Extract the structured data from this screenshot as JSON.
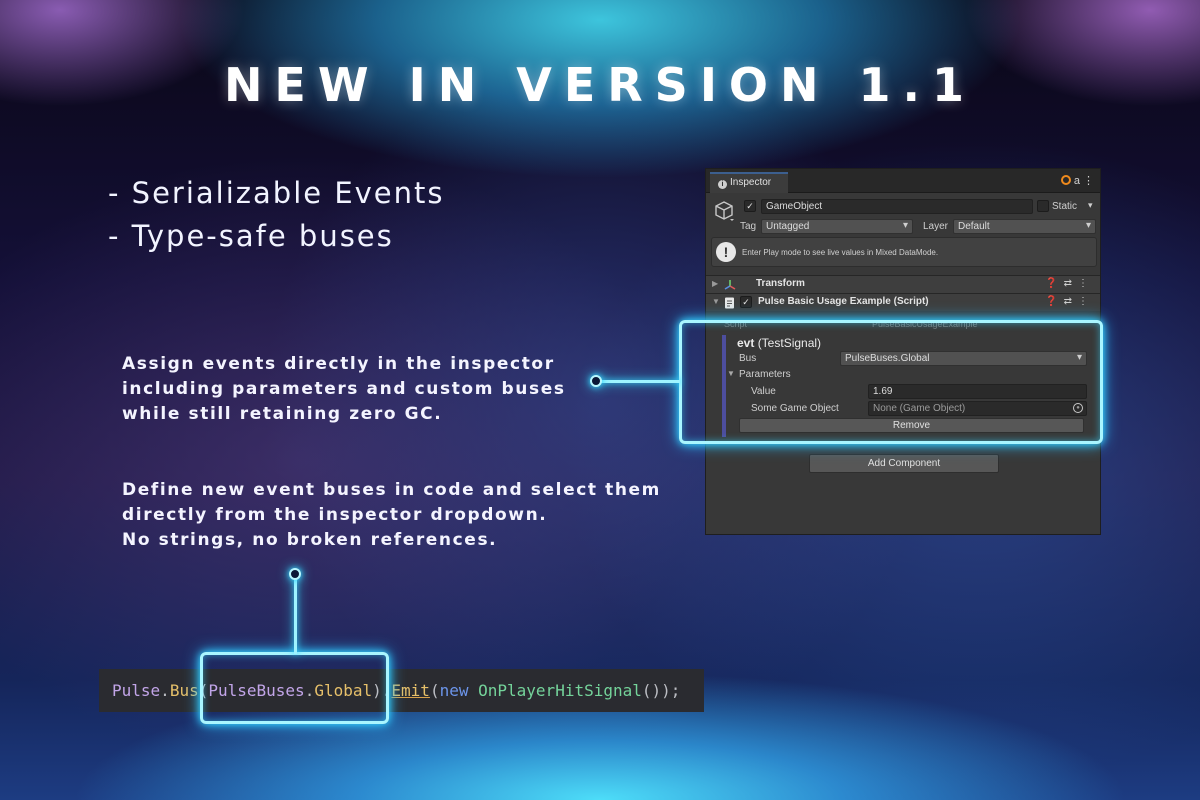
{
  "title": "NEW IN VERSION 1.1",
  "bullets": [
    "- Serializable Events",
    "- Type-safe buses"
  ],
  "paragraph1": [
    "Assign events directly in the inspector",
    "including parameters and custom buses",
    "while still retaining zero GC."
  ],
  "paragraph2": [
    "Define new event buses in code and select them",
    "directly from the inspector dropdown.",
    "No strings, no broken references."
  ],
  "inspector": {
    "tab_label": "Inspector",
    "tab_icon_text": "a",
    "gameobject": {
      "name": "GameObject",
      "static_label": "Static",
      "tag_label": "Tag",
      "tag_value": "Untagged",
      "layer_label": "Layer",
      "layer_value": "Default"
    },
    "help_message": "Enter Play mode to see live values in Mixed DataMode.",
    "components": {
      "transform": "Transform",
      "script": "Pulse Basic Usage Example (Script)"
    },
    "script_field": {
      "label": "Script",
      "value": "PulseBasicUsageExample"
    },
    "evt": {
      "name": "evt",
      "type": "(TestSignal)",
      "bus_label": "Bus",
      "bus_value": "PulseBuses.Global",
      "parameters_label": "Parameters",
      "value_label": "Value",
      "value": "1.69",
      "gameobject_label": "Some Game Object",
      "gameobject_value": "None (Game Object)",
      "remove_label": "Remove"
    },
    "add_component_label": "Add Component"
  },
  "code": {
    "pulse": "Pulse",
    "dot1": ".",
    "bus": "Bus",
    "open1": "(",
    "pulsebuses": "PulseBuses",
    "dot2": ".",
    "global": "Global",
    "close1": ")",
    "dot3": ".",
    "emit": "Emit",
    "open2": "(",
    "new_kw": "new",
    "space": " ",
    "signal": "OnPlayerHitSignal",
    "tail": "());"
  },
  "colors": {
    "accent_glow": "#35d6ff",
    "inspector_bg": "#383838",
    "code_bg": "#2a2b30"
  }
}
